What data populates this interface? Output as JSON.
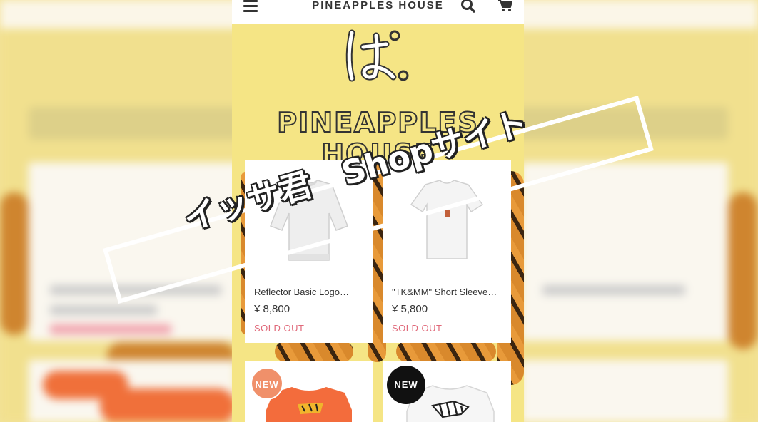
{
  "header": {
    "brand": "PINEAPPLES HOUSE",
    "menu_icon": "hamburger-menu-icon",
    "search_icon": "search-icon",
    "cart_icon": "cart-icon"
  },
  "hero": {
    "logo_glyph": "ぱ。",
    "logo_text": "PINEAPPLES HOUSE"
  },
  "products": [
    {
      "name": "Reflector Basic Logo…",
      "price": "¥ 8,800",
      "status": "SOLD OUT"
    },
    {
      "name": "\"TK&MM\" Short Sleeve…",
      "price": "¥ 5,800",
      "status": "SOLD OUT"
    },
    {
      "badge": "NEW",
      "badge_color": "#f0906a"
    },
    {
      "badge": "NEW",
      "badge_color": "#111111"
    }
  ],
  "overlay": {
    "caption": "イッサ君　Shopサイト"
  },
  "colors": {
    "accent_yellow": "#f5e585",
    "sold_out": "#e0697a",
    "badge_orange": "#f0906a",
    "badge_black": "#111111"
  }
}
